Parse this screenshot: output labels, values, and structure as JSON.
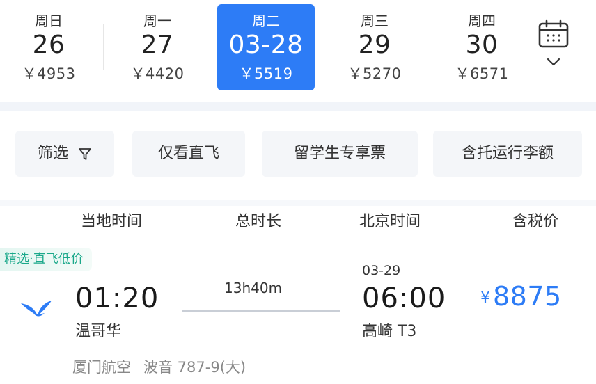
{
  "dates": [
    {
      "weekday": "周日",
      "day": "26",
      "price": "￥4953",
      "selected": false
    },
    {
      "weekday": "周一",
      "day": "27",
      "price": "￥4420",
      "selected": false
    },
    {
      "weekday": "周二",
      "day": "03-28",
      "price": "￥5519",
      "selected": true
    },
    {
      "weekday": "周三",
      "day": "29",
      "price": "￥5270",
      "selected": false
    },
    {
      "weekday": "周四",
      "day": "30",
      "price": "￥6571",
      "selected": false
    }
  ],
  "filters": {
    "filter_label": "筛选",
    "nonstop_label": "仅看直飞",
    "student_label": "留学生专享票",
    "baggage_label": "含托运行李额"
  },
  "columns": {
    "local_time": "当地时间",
    "duration": "总时长",
    "beijing_time": "北京时间",
    "price_incl_tax": "含税价"
  },
  "flight": {
    "tag": "精选·直飞低价",
    "dep_time": "01:20",
    "dep_city": "温哥华",
    "duration": "13h40m",
    "arr_date": "03-29",
    "arr_time": "06:00",
    "arr_city": "高崎 T3",
    "currency": "¥",
    "price": "8875",
    "airline": "厦门航空",
    "aircraft": "波音 787-9(大)"
  },
  "colors": {
    "accent": "#2d7cf6",
    "tag_green": "#1aa88a"
  }
}
